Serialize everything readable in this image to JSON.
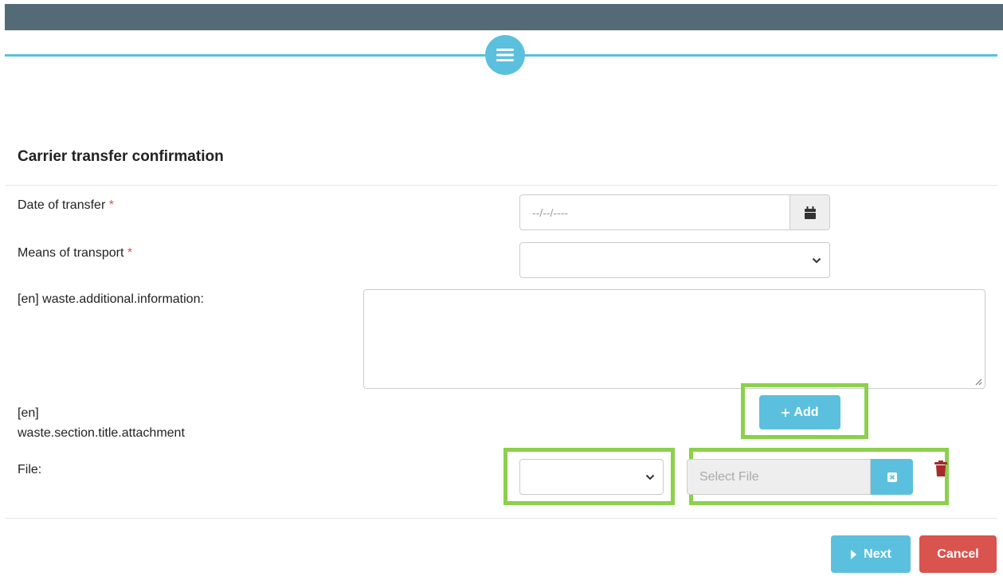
{
  "header": {
    "menu_icon": "hamburger-icon"
  },
  "form": {
    "title": "Carrier transfer confirmation",
    "date_label": "Date of transfer",
    "date_placeholder": "--/--/----",
    "transport_label": "Means of transport",
    "required_mark": "*",
    "additional_info_label": "[en] waste.additional.information:",
    "attachment_label_line1": "[en]",
    "attachment_label_line2": "waste.section.title.attachment",
    "add_button_label": "Add",
    "file_label": "File:",
    "file_placeholder": "Select File"
  },
  "footer": {
    "next_label": "Next",
    "cancel_label": "Cancel"
  },
  "colors": {
    "header_bar": "#546a77",
    "accent": "#5bc0de",
    "danger": "#d9534f",
    "highlight": "#8cd04b"
  }
}
